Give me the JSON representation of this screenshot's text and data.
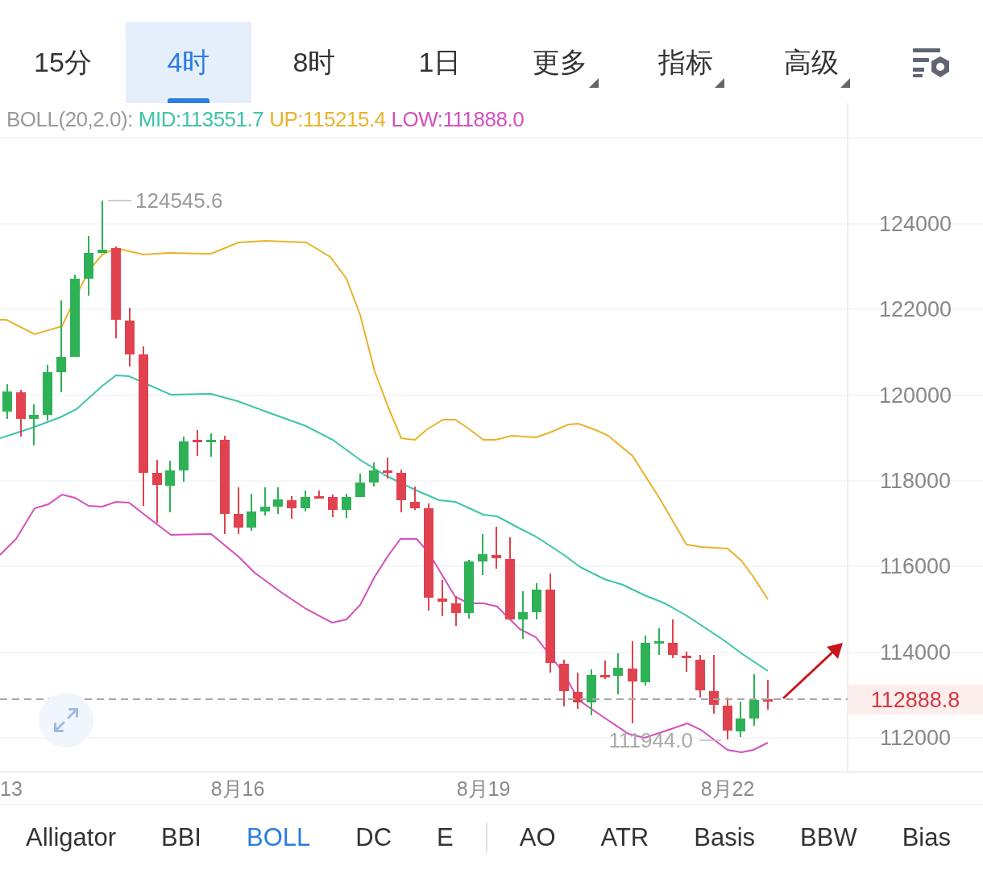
{
  "timeframe_tabs": [
    {
      "label": "15分",
      "selected": false,
      "kind": "plain"
    },
    {
      "label": "4时",
      "selected": true,
      "kind": "plain"
    },
    {
      "label": "8时",
      "selected": false,
      "kind": "plain"
    },
    {
      "label": "1日",
      "selected": false,
      "kind": "plain"
    },
    {
      "label": "更多",
      "selected": false,
      "kind": "menu"
    },
    {
      "label": "指标",
      "selected": false,
      "kind": "menu"
    },
    {
      "label": "高级",
      "selected": false,
      "kind": "menu"
    }
  ],
  "chart": {
    "legend": {
      "name": "BOLL(20,2.0):",
      "mid": "MID:113551.7",
      "up": "UP:115215.4",
      "low": "LOW:111888.0"
    },
    "price_axis": [
      "124000",
      "122000",
      "120000",
      "118000",
      "116000",
      "114000",
      "112000"
    ],
    "current_price": "112888.8",
    "high_marker": "124545.6",
    "low_marker": "111944.0",
    "date_axis": [
      "13",
      "8月16",
      "8月19",
      "8月22"
    ]
  },
  "indicator_tabs": {
    "main": [
      {
        "label": "Alligator",
        "selected": false
      },
      {
        "label": "BBI",
        "selected": false
      },
      {
        "label": "BOLL",
        "selected": true
      },
      {
        "label": "DC",
        "selected": false
      },
      {
        "label": "E",
        "selected": false
      }
    ],
    "sub": [
      {
        "label": "AO",
        "selected": false
      },
      {
        "label": "ATR",
        "selected": false
      },
      {
        "label": "Basis",
        "selected": false
      },
      {
        "label": "BBW",
        "selected": false
      },
      {
        "label": "Bias",
        "selected": false
      }
    ]
  }
}
